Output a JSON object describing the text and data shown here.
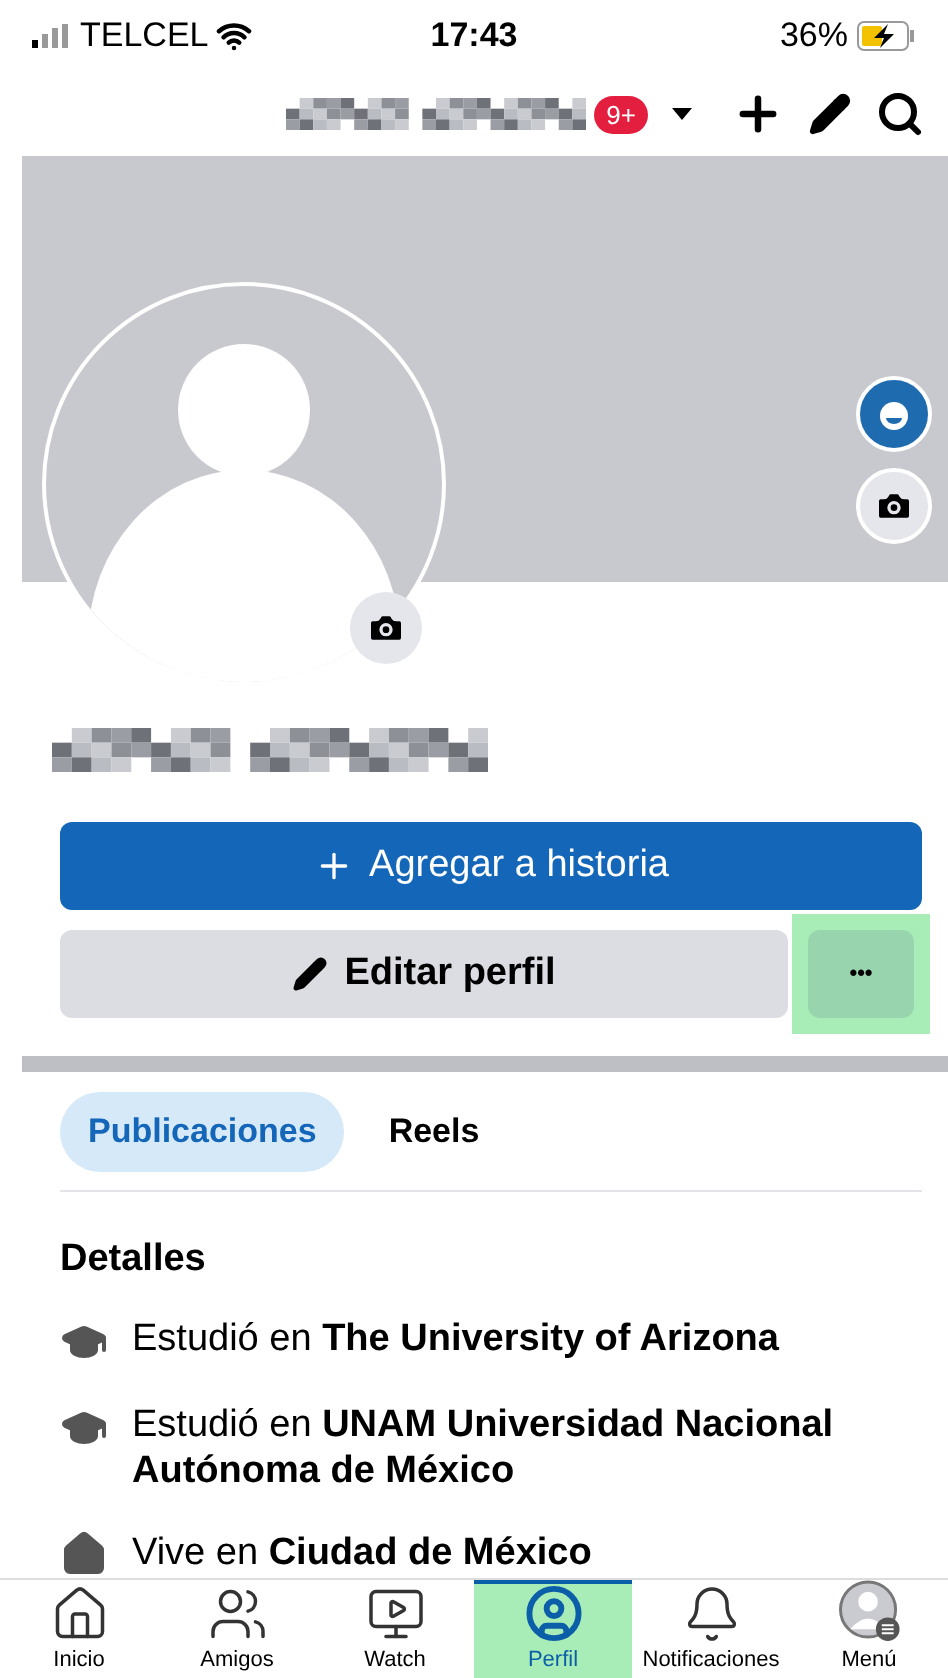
{
  "status_bar": {
    "carrier": "TELCEL",
    "time": "17:43",
    "battery": "36%",
    "charging": true
  },
  "header": {
    "notification_count": "9+"
  },
  "actions": {
    "add_story": "Agregar a historia",
    "edit_profile": "Editar perfil",
    "more": {
      "label": "•••",
      "highlighted": true
    }
  },
  "tabs": [
    {
      "label": "Publicaciones",
      "selected": true
    },
    {
      "label": "Reels",
      "selected": false
    }
  ],
  "details": {
    "title": "Detalles",
    "items": [
      {
        "kind": "education",
        "text": "Estudió en **The University of Arizona**"
      },
      {
        "kind": "education",
        "text": "Estudió en **UNAM Universidad Nacional Autónoma de México**"
      },
      {
        "kind": "home",
        "text": "Vive en **Ciudad de México**"
      }
    ]
  },
  "bottom_nav": [
    {
      "kind": "home",
      "label": "Inicio",
      "selected": false,
      "highlighted": false
    },
    {
      "kind": "friends",
      "label": "Amigos",
      "selected": false,
      "highlighted": false
    },
    {
      "kind": "watch",
      "label": "Watch",
      "selected": false,
      "highlighted": false
    },
    {
      "kind": "profile",
      "label": "Perfil",
      "selected": true,
      "highlighted": true
    },
    {
      "kind": "bell",
      "label": "Notificaciones",
      "selected": false,
      "highlighted": false
    },
    {
      "kind": "menu",
      "label": "Menú",
      "selected": false,
      "highlighted": false
    }
  ]
}
